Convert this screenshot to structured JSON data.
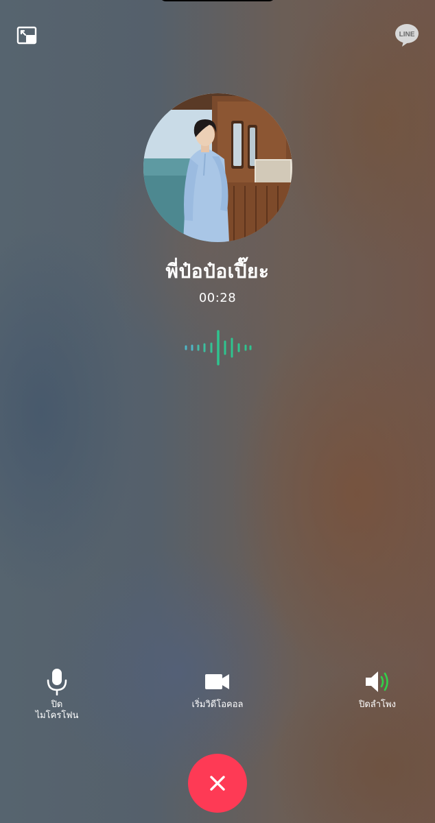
{
  "call": {
    "caller_name": "พี่ป๋อป๋อเปี๊ยะ",
    "duration": "00:28"
  },
  "header": {
    "pip_icon": "pip-minimize-icon",
    "logo_text": "LINE"
  },
  "controls": {
    "mic": {
      "label_line1": "ปิด",
      "label_line2": "ไมโครโฟน",
      "icon": "microphone-icon"
    },
    "video": {
      "label": "เริ่มวิดีโอคอล",
      "icon": "video-camera-icon"
    },
    "speaker": {
      "label": "ปิดลำโพง",
      "icon": "speaker-on-icon"
    }
  },
  "end_call": {
    "icon": "close-x-icon",
    "color": "#fe3a55"
  },
  "colors": {
    "wave_green": "#2fc48f",
    "wave_teal": "#4fb7c6",
    "speaker_wave": "#31d24a",
    "line_logo_bg": "#d8d8d8"
  }
}
